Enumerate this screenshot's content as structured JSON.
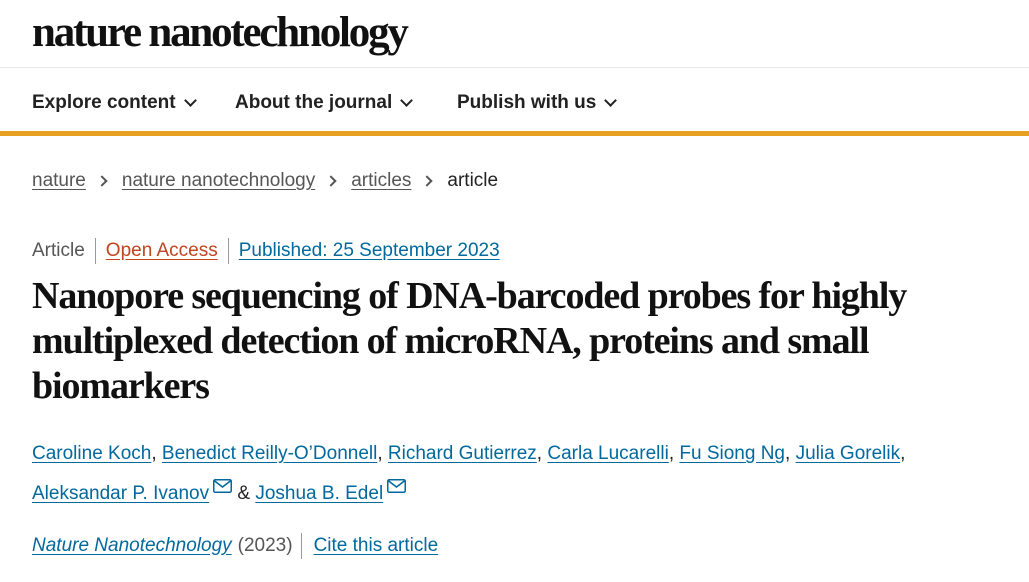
{
  "header": {
    "logo": "nature nanotechnology"
  },
  "nav": {
    "items": [
      {
        "label": "Explore content",
        "icon": "chevron-down-icon"
      },
      {
        "label": "About the journal",
        "icon": "chevron-down-icon"
      },
      {
        "label": "Publish with us",
        "icon": "chevron-down-icon"
      }
    ]
  },
  "breadcrumb": {
    "items": [
      "nature",
      "nature nanotechnology",
      "articles"
    ],
    "current": "article"
  },
  "article": {
    "type": "Article",
    "access": "Open Access",
    "published": "Published: 25 September 2023",
    "title": "Nanopore sequencing of DNA-barcoded probes for highly multiplexed detection of microRNA, proteins and small biomarkers",
    "authors": [
      "Caroline Koch",
      "Benedict Reilly-O’Donnell",
      "Richard Gutierrez",
      "Carla Lucarelli",
      "Fu Siong Ng",
      "Julia Gorelik",
      "Aleksandar P. Ivanov",
      "Joshua B. Edel"
    ],
    "author_separator": ",",
    "author_conjunction": "&",
    "journal": "Nature Nanotechnology",
    "year": "(2023)",
    "cite_label": "Cite this article"
  },
  "colors": {
    "accent_bar": "#e8a020",
    "link": "#00699d",
    "open_access": "#c0441e",
    "muted": "#555555"
  }
}
